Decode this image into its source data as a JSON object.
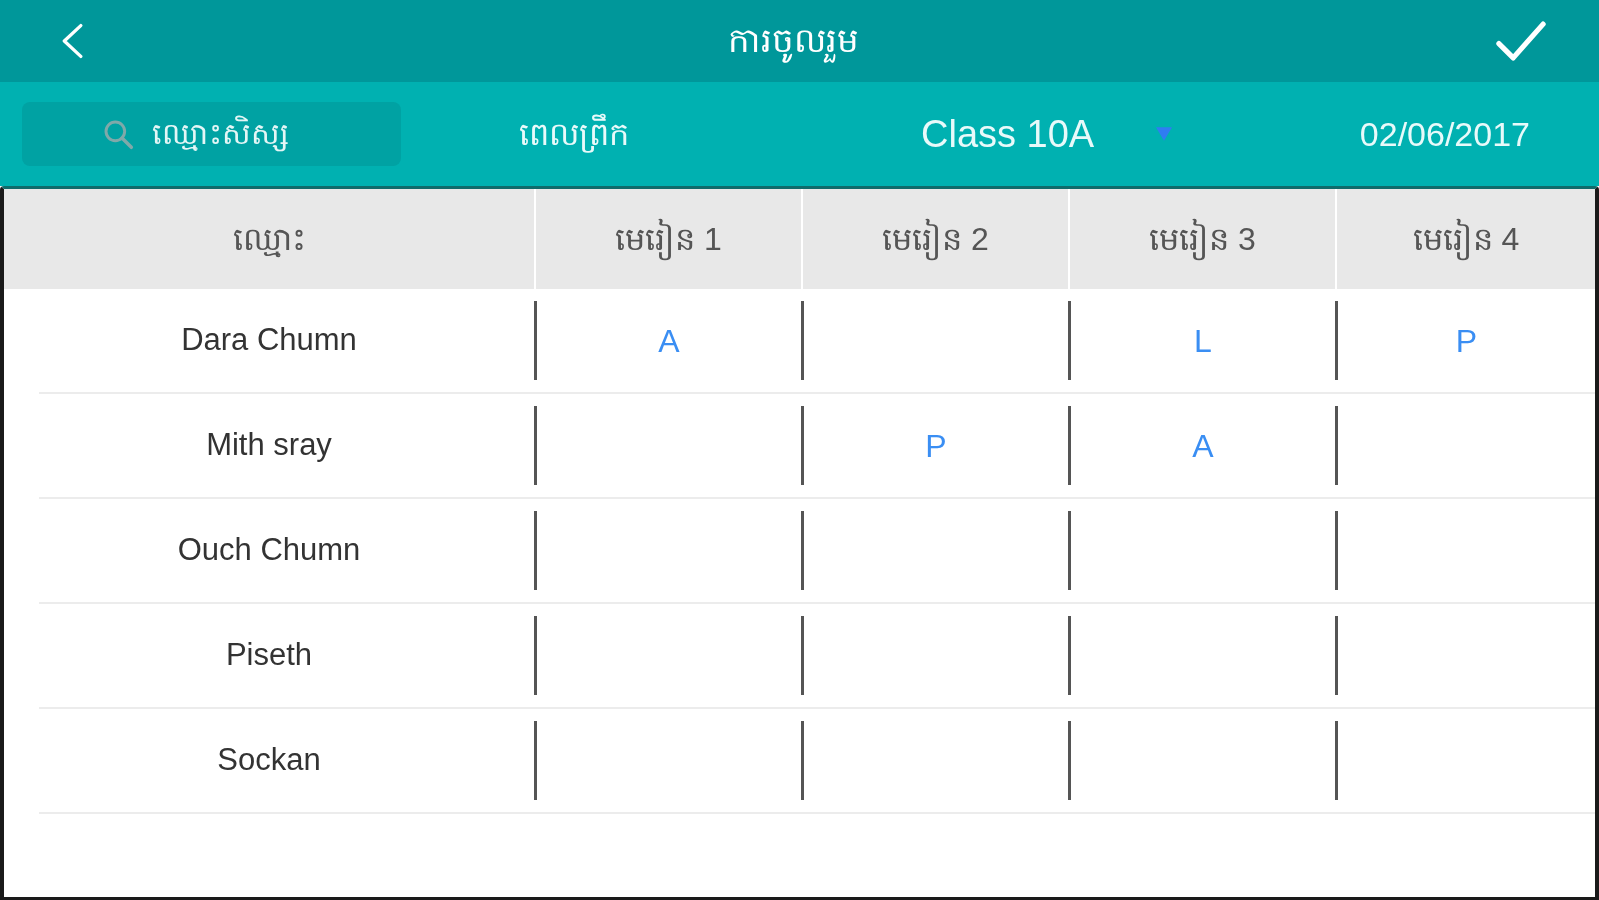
{
  "top_bar": {
    "title": "ការចូលរួម"
  },
  "filter_bar": {
    "search": {
      "placeholder": "ឈ្មោះសិស្ស"
    },
    "session": "ពេលព្រឹក",
    "class_select": {
      "value": "Class 10A"
    },
    "date": "02/06/2017"
  },
  "table": {
    "columns": [
      "ឈ្មោះ",
      "មេរៀន 1",
      "មេរៀន 2",
      "មេរៀន 3",
      "មេរៀន 4"
    ],
    "rows": [
      {
        "name": "Dara Chumn",
        "lesson_1": "A",
        "lesson_3": "L",
        "lesson_4": "P"
      },
      {
        "name": "Mith sray",
        "lesson_2": "P",
        "lesson_3": "A"
      },
      {
        "name": "Ouch Chumn"
      },
      {
        "name": "Piseth"
      },
      {
        "name": "Sockan"
      }
    ]
  }
}
